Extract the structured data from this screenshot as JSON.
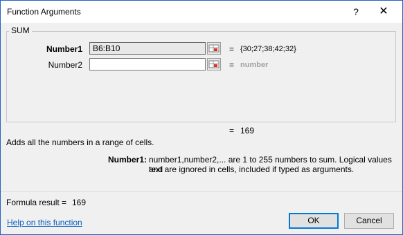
{
  "window": {
    "title": "Function Arguments",
    "help_glyph": "?",
    "close_glyph": "✕"
  },
  "function_group": {
    "name": "SUM",
    "arguments": [
      {
        "label": "Number1",
        "value": "B6:B10",
        "equals": "=",
        "result": "{30;27;38;42;32}"
      },
      {
        "label": "Number2",
        "value": "",
        "equals": "=",
        "result": "number"
      }
    ]
  },
  "overall": {
    "equals": "=",
    "value": "169"
  },
  "description": "Adds all the numbers in a range of cells.",
  "arg_help": {
    "label": "Number1:",
    "line1": "number1,number2,... are 1 to 255 numbers to sum. Logical values and",
    "line2": "text are ignored in cells, included if typed as arguments."
  },
  "formula_result": {
    "label": "Formula result =",
    "value": "169"
  },
  "help_link": "Help on this function",
  "buttons": {
    "ok": "OK",
    "cancel": "Cancel"
  },
  "icons": {
    "ref_button": "range-select-icon"
  }
}
